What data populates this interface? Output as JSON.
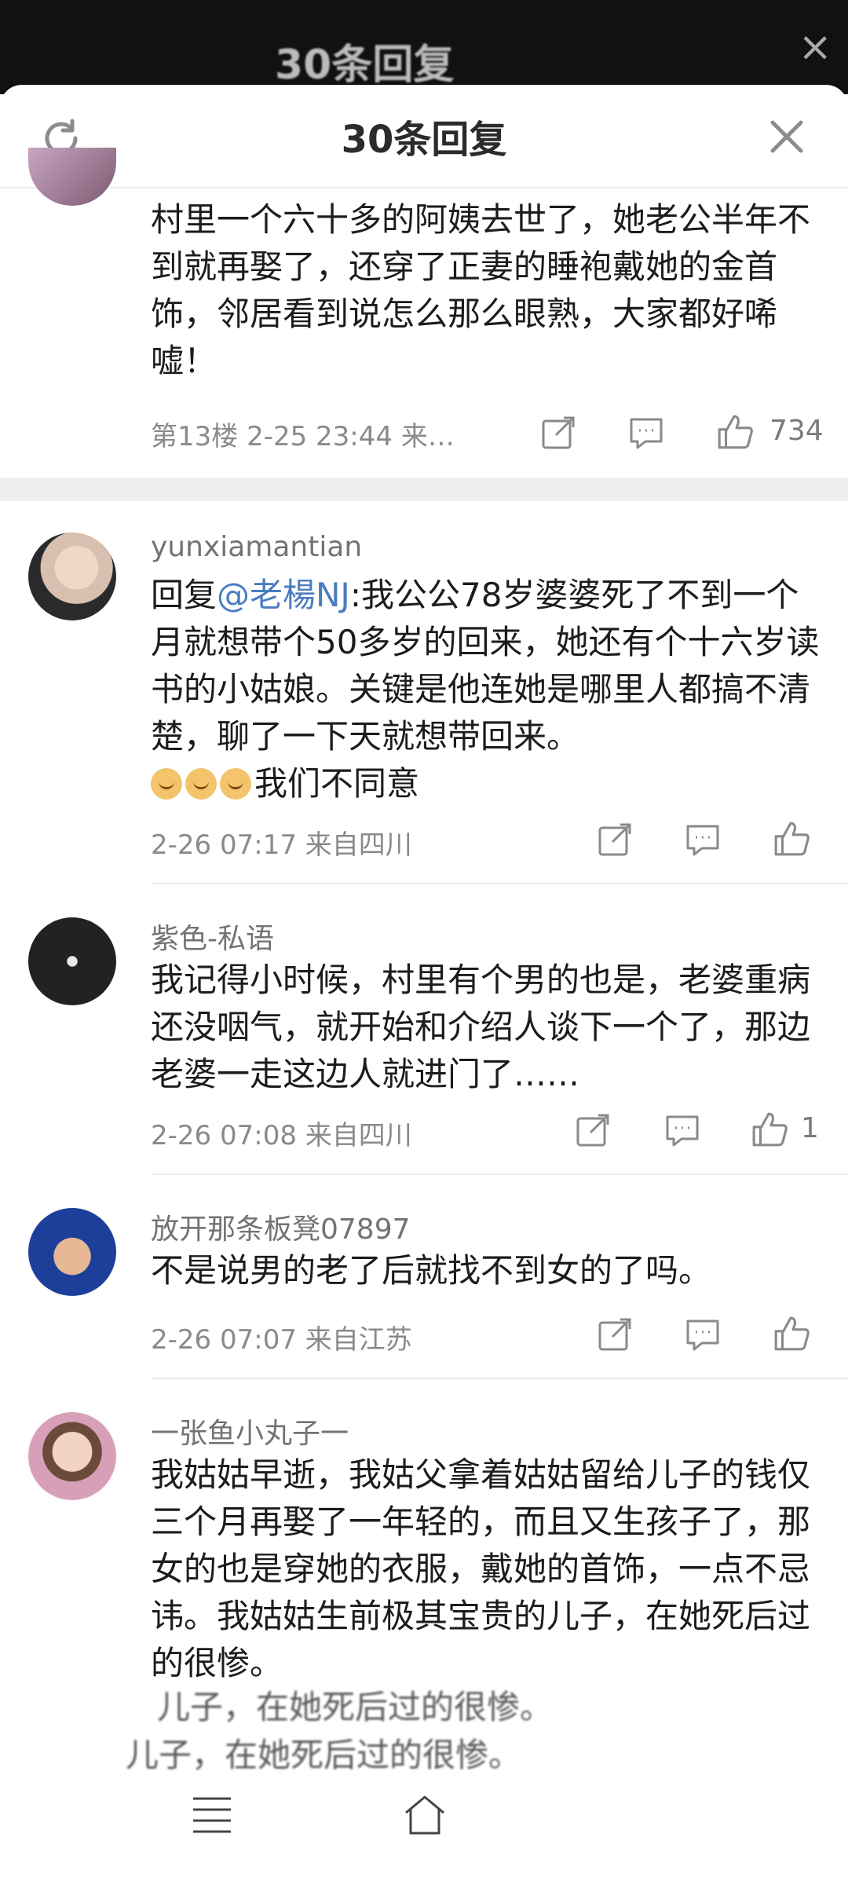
{
  "sheet": {
    "title": "30条回复",
    "ghost_title": "30条回复"
  },
  "comments": [
    {
      "text": "村里一个六十多的阿姨去世了，她老公半年不到就再娶了，还穿了正妻的睡袍戴她的金首饰，邻居看到说怎么那么眼熟，大家都好唏嘘！",
      "meta": "第13楼  2-25 23:44  来…",
      "likes": "734"
    },
    {
      "username": "yunxiamantian",
      "reply_prefix": "回复",
      "mention": "@老楊NJ",
      "text_after_mention": ":我公公78岁婆婆死了不到一个月就想带个50多岁的回来，她还有个十六岁读书的小姑娘。关键是他连她是哪里人都搞不清楚，聊了一下天就想带回来。",
      "emoji_suffix": "我们不同意",
      "meta": "2-26 07:17  来自四川"
    },
    {
      "username": "紫色-私语",
      "text": "我记得小时候，村里有个男的也是，老婆重病还没咽气，就开始和介绍人谈下一个了，那边老婆一走这边人就进门了……",
      "meta": "2-26 07:08  来自四川",
      "likes": "1"
    },
    {
      "username": "放开那条板凳07897",
      "text": "不是说男的老了后就找不到女的了吗。",
      "meta": "2-26 07:07  来自江苏"
    },
    {
      "username": "一张鱼小丸子一",
      "text": "我姑姑早逝，我姑父拿着姑姑留给儿子的钱仅三个月再娶了一年轻的，而且又生孩子了，那女的也是穿她的衣服，戴她的首饰，一点不忌讳。我姑姑生前极其宝贵的儿子，在她死后过的很惨。"
    }
  ],
  "bottom_ghost": {
    "line1": "儿子，在她死后过的很惨。",
    "line2": "儿子，在她死后过的很惨。"
  },
  "colors": {
    "mention": "#4a7cc1",
    "meta": "#8a8a8a",
    "divider": "#ececec"
  },
  "icons": [
    "refresh-icon",
    "close-icon",
    "share-icon",
    "comment-icon",
    "like-icon",
    "menu-icon",
    "home-icon"
  ]
}
